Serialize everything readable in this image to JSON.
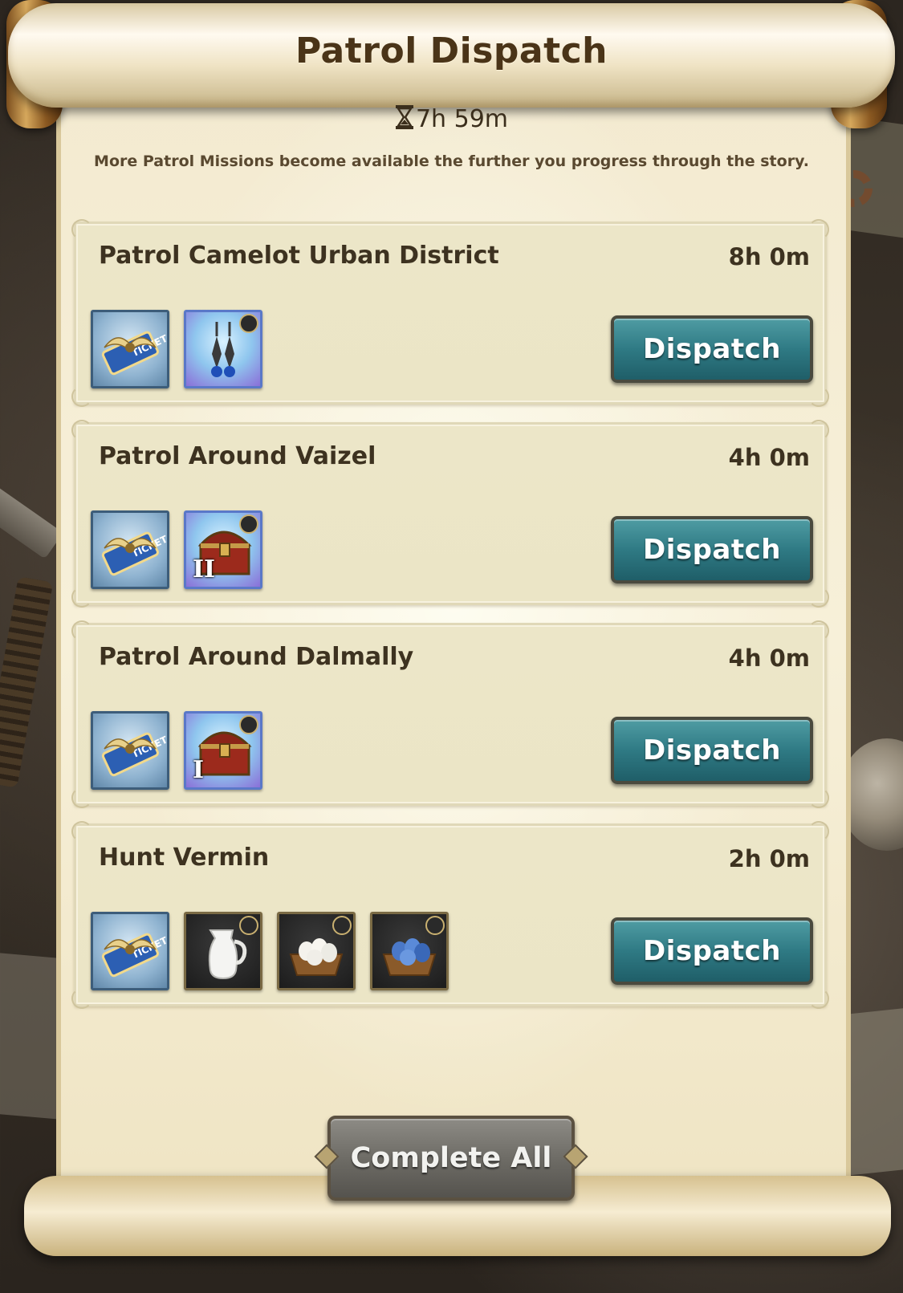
{
  "header": {
    "title": "Patrol Dispatch",
    "timer": "7h 59m",
    "subtitle": "More Patrol Missions become available the further you progress through the story."
  },
  "missions": [
    {
      "name": "Patrol Camelot Urban District",
      "duration": "8h 0m",
      "rewards": [
        "ticket-icon",
        "earrings-icon"
      ],
      "button": "Dispatch"
    },
    {
      "name": "Patrol Around Vaizel",
      "duration": "4h 0m",
      "rewards": [
        "ticket-icon",
        "treasure-chest-icon"
      ],
      "chest_rank": "II",
      "button": "Dispatch"
    },
    {
      "name": "Patrol Around Dalmally",
      "duration": "4h 0m",
      "rewards": [
        "ticket-icon",
        "treasure-chest-icon"
      ],
      "chest_rank": "I",
      "button": "Dispatch"
    },
    {
      "name": "Hunt Vermin",
      "duration": "2h 0m",
      "rewards": [
        "ticket-icon",
        "milk-jug-icon",
        "egg-basket-icon",
        "blue-egg-basket-icon"
      ],
      "button": "Dispatch"
    }
  ],
  "footer": {
    "complete_all": "Complete All"
  },
  "colors": {
    "dispatch_button": "#2f7a84",
    "complete_all_button": "#6e6c66",
    "parchment": "#f3ead0",
    "mission_card": "#ece6c8",
    "text_dark": "#3d3220"
  }
}
